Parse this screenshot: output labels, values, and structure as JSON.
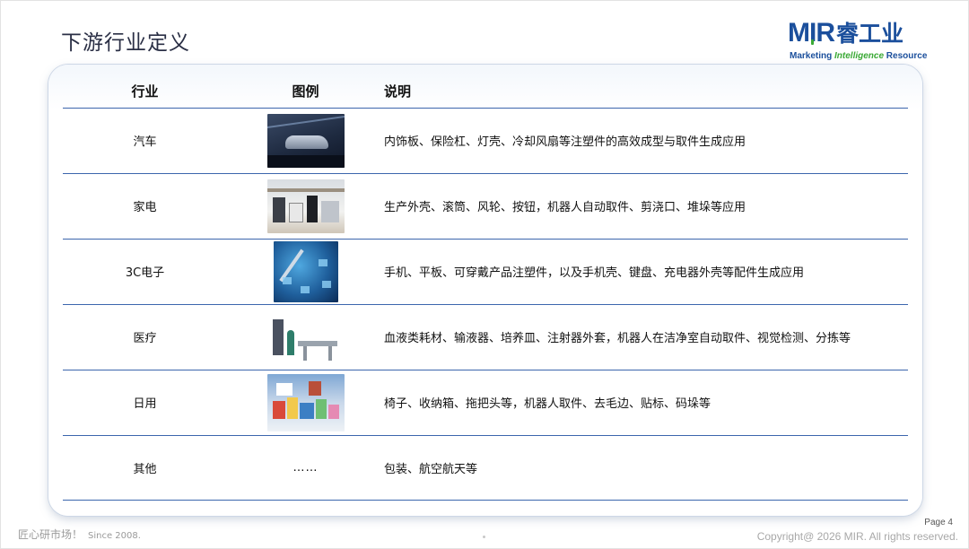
{
  "title": "下游行业定义",
  "logo": {
    "brand": "MIR",
    "cn": "睿工业",
    "tagline_left": "Marketing ",
    "tagline_mid": "Intelligence",
    "tagline_right": " Resource"
  },
  "table": {
    "headers": {
      "industry": "行业",
      "image": "图例",
      "description": "说明"
    },
    "rows": [
      {
        "industry": "汽车",
        "image": "car-image",
        "description": "内饰板、保险杠、灯壳、冷却风扇等注塑件的高效成型与取件生成应用"
      },
      {
        "industry": "家电",
        "image": "appliance-image",
        "description": "生产外壳、滚筒、风轮、按钮，机器人自动取件、剪浇口、堆垛等应用"
      },
      {
        "industry": "3C电子",
        "image": "electronics-image",
        "description": "手机、平板、可穿戴产品注塑件，以及手机壳、键盘、充电器外壳等配件生成应用"
      },
      {
        "industry": "医疗",
        "image": "medical-image",
        "description": "血液类耗材、输液器、培养皿、注射器外套，机器人在洁净室自动取件、视觉检测、分拣等"
      },
      {
        "industry": "日用",
        "image": "daily-goods-image",
        "description": "椅子、收纳箱、拖把头等，机器人取件、去毛边、贴标、码垛等"
      },
      {
        "industry": "其他",
        "image_text": "……",
        "description": "包装、航空航天等"
      }
    ]
  },
  "footer": {
    "slogan": "匠心研市场！",
    "since": "Since 2008.",
    "page": "Page 4",
    "copyright": "Copyright@ 2026 MIR. All rights reserved."
  },
  "colors": {
    "accent": "#1b4f9c",
    "green": "#3aa935",
    "rule": "#3c66ad"
  }
}
